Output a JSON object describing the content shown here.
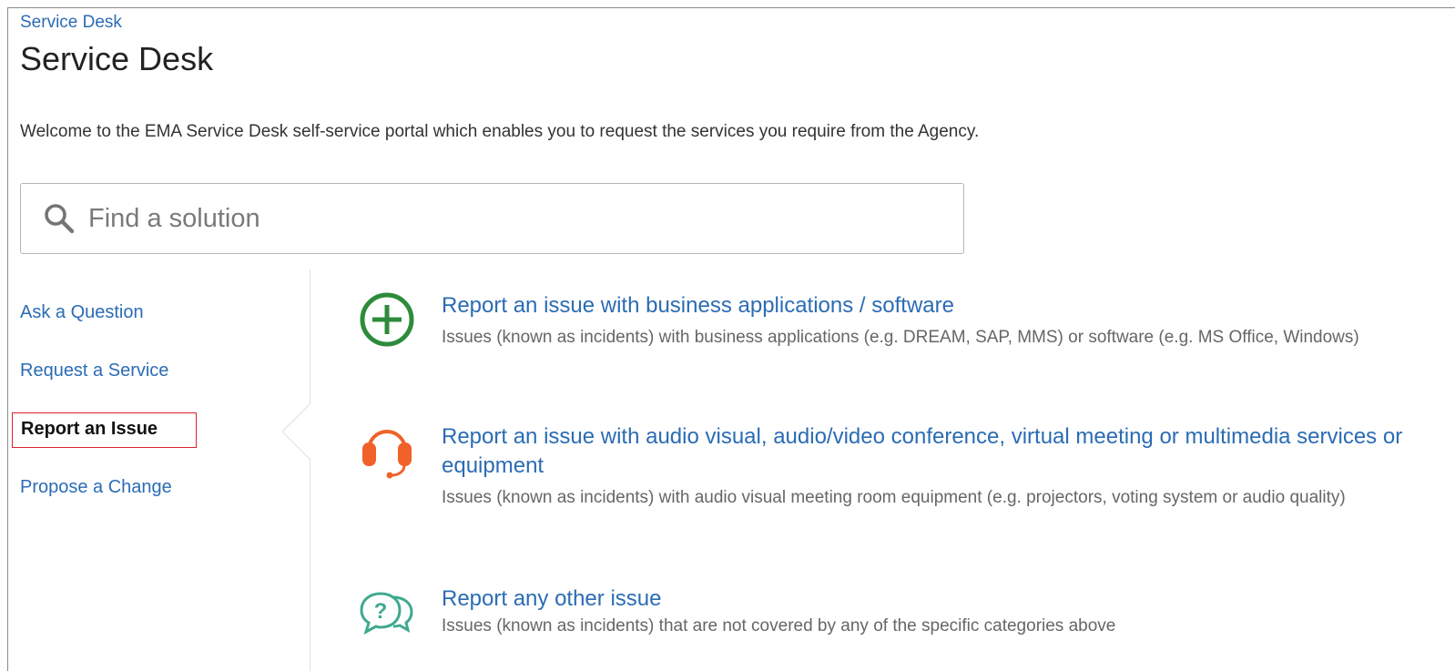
{
  "breadcrumb": "Service Desk",
  "title": "Service Desk",
  "welcome": "Welcome to the EMA Service Desk self-service portal which enables you to request the services you require from the Agency.",
  "search": {
    "placeholder": "Find a solution"
  },
  "sidebar": {
    "items": [
      {
        "label": "Ask a Question",
        "active": false
      },
      {
        "label": "Request a Service",
        "active": false
      },
      {
        "label": "Report an Issue",
        "active": true
      },
      {
        "label": "Propose a Change",
        "active": false
      }
    ]
  },
  "options": [
    {
      "icon": "plus-circle-icon",
      "color": "#2e8b3c",
      "title": "Report an issue with business applications / software",
      "description": "Issues (known as incidents) with business applications (e.g. DREAM, SAP, MMS) or software (e.g. MS Office, Windows)"
    },
    {
      "icon": "headset-icon",
      "color": "#f0622a",
      "title": "Report an issue with audio visual, audio/video conference, virtual meeting or multimedia services or equipment",
      "description": "Issues (known as incidents) with audio visual meeting room equipment (e.g. projectors, voting system or audio quality)"
    },
    {
      "icon": "question-chat-icon",
      "color": "#3fa98f",
      "title": "Report any other issue",
      "description": "Issues (known as incidents) that are not covered by any of the specific categories above"
    }
  ]
}
